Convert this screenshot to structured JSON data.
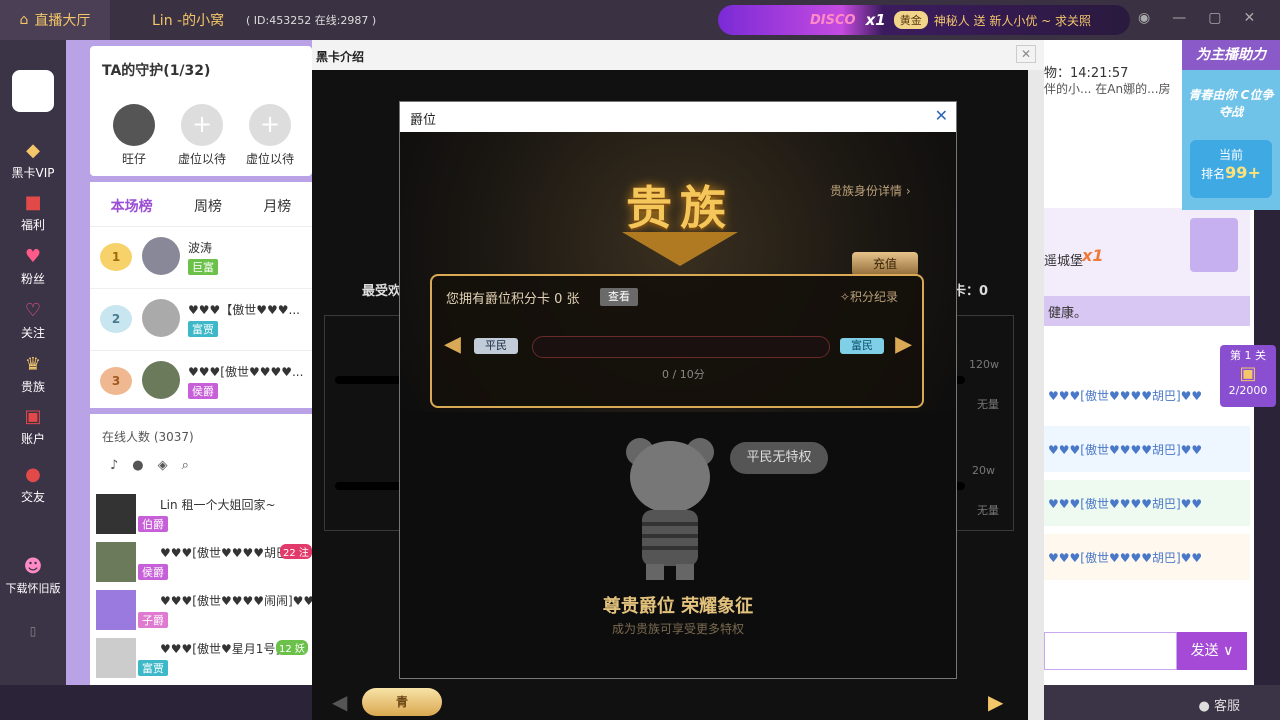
{
  "topbar": {
    "home": "直播大厅",
    "anchor": "Lin -的小窝",
    "room_info": "( ID:453252  在线:2987 )",
    "banner": {
      "disco": "DISCO",
      "x1": "x1",
      "gold": "黄金",
      "message": "神秘人 送 新人小优 ~ 求关照"
    }
  },
  "leftnav": [
    "黑卡VIP",
    "福利",
    "粉丝",
    "关注",
    "贵族",
    "账户",
    "交友",
    "下载怀旧版"
  ],
  "guard": {
    "title": "TA的守护(1/32)",
    "slots": [
      "旺仔",
      "虚位以待",
      "虚位以待"
    ]
  },
  "rank": {
    "tabs": [
      "本场榜",
      "周榜",
      "月榜"
    ],
    "rows": [
      {
        "medal": "1",
        "name": "波涛",
        "badge": "巨富"
      },
      {
        "medal": "2",
        "name": "♥♥♥【傲世♥♥♥...",
        "badge": "富贾"
      },
      {
        "medal": "3",
        "name": "♥♥♥[傲世♥♥♥♥...",
        "badge": "侯爵"
      }
    ]
  },
  "online": {
    "title": "在线人数 (3037)",
    "rows": [
      {
        "name": "Lin 租一个大姐回家~",
        "badge": "伯爵"
      },
      {
        "name": "♥♥♥[傲世♥♥♥♥胡巴]...",
        "badge": "侯爵",
        "tag": "22 注"
      },
      {
        "name": "♥♥♥[傲世♥♥♥♥闹闹]♥♥♥",
        "badge": "子爵"
      },
      {
        "name": "♥♥♥[傲世♥星月1号]...",
        "badge": "富贾",
        "tag": "12 妖"
      }
    ]
  },
  "center": {
    "title": "黑卡介绍",
    "label_left": "最受欢",
    "label_right": "卡：0",
    "scale_top": "120w",
    "scale_bottom": "20w",
    "unlimited": "无量",
    "pill": "青"
  },
  "chat": {
    "time": "物：14:21:57",
    "sub": "伴的小... 在An娜的...房",
    "castle": "遥城堡",
    "x1": "x1",
    "health": "健康。",
    "rows": [
      "♥♥♥[傲世♥♥♥♥胡巴]♥♥",
      "♥♥♥[傲世♥♥♥♥胡巴]♥♥",
      "♥♥♥[傲世♥♥♥♥胡巴]♥♥",
      "♥♥♥[傲世♥♥♥♥胡巴]♥♥"
    ],
    "send": "发送"
  },
  "promo": {
    "title": "为主播助力",
    "subtitle": "青春由你 C位争夺战",
    "current": "当前",
    "rank_label": "排名",
    "rank_value": "99+",
    "level": "第 1 关",
    "level_progress": "2/2000"
  },
  "bottom": {
    "service": "客服"
  },
  "dialog": {
    "title": "爵位",
    "noble": "贵族",
    "details": "贵族身份详情 ›",
    "recharge": "充值",
    "owned_text": "您拥有爵位积分卡  0 张",
    "view": "查看",
    "record": "积分纪录",
    "from_rank": "平民",
    "to_rank": "富民",
    "points": "0 / 10分",
    "bubble": "平民无特权",
    "slogan": "尊贵爵位  荣耀象征",
    "sub": "成为贵族可享受更多特权"
  }
}
